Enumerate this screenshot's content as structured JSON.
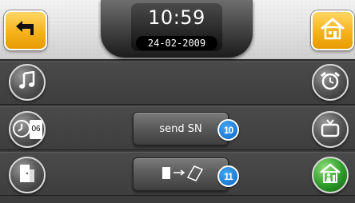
{
  "clock": {
    "time": "10:59",
    "date": "24-02-2009"
  },
  "header": {
    "back_icon": "back-arrow-icon",
    "home_icon": "home-icon"
  },
  "rows": [
    {
      "left_icon": "music-note-icon",
      "right_icon": "alarm-clock-icon"
    },
    {
      "left_icon": "clock-calendar-icon",
      "left_badge_text": "06",
      "button_label": "send SN",
      "button_badge": "10",
      "right_icon": "tv-icon"
    },
    {
      "left_icon": "door-icon",
      "button_icon": "phone-to-device-icon",
      "button_badge": "11",
      "right_icon": "home-person-icon"
    }
  ],
  "colors": {
    "accent_orange": "#f7b21c",
    "badge_blue": "#1b7fd9",
    "green": "#2c9a28"
  }
}
